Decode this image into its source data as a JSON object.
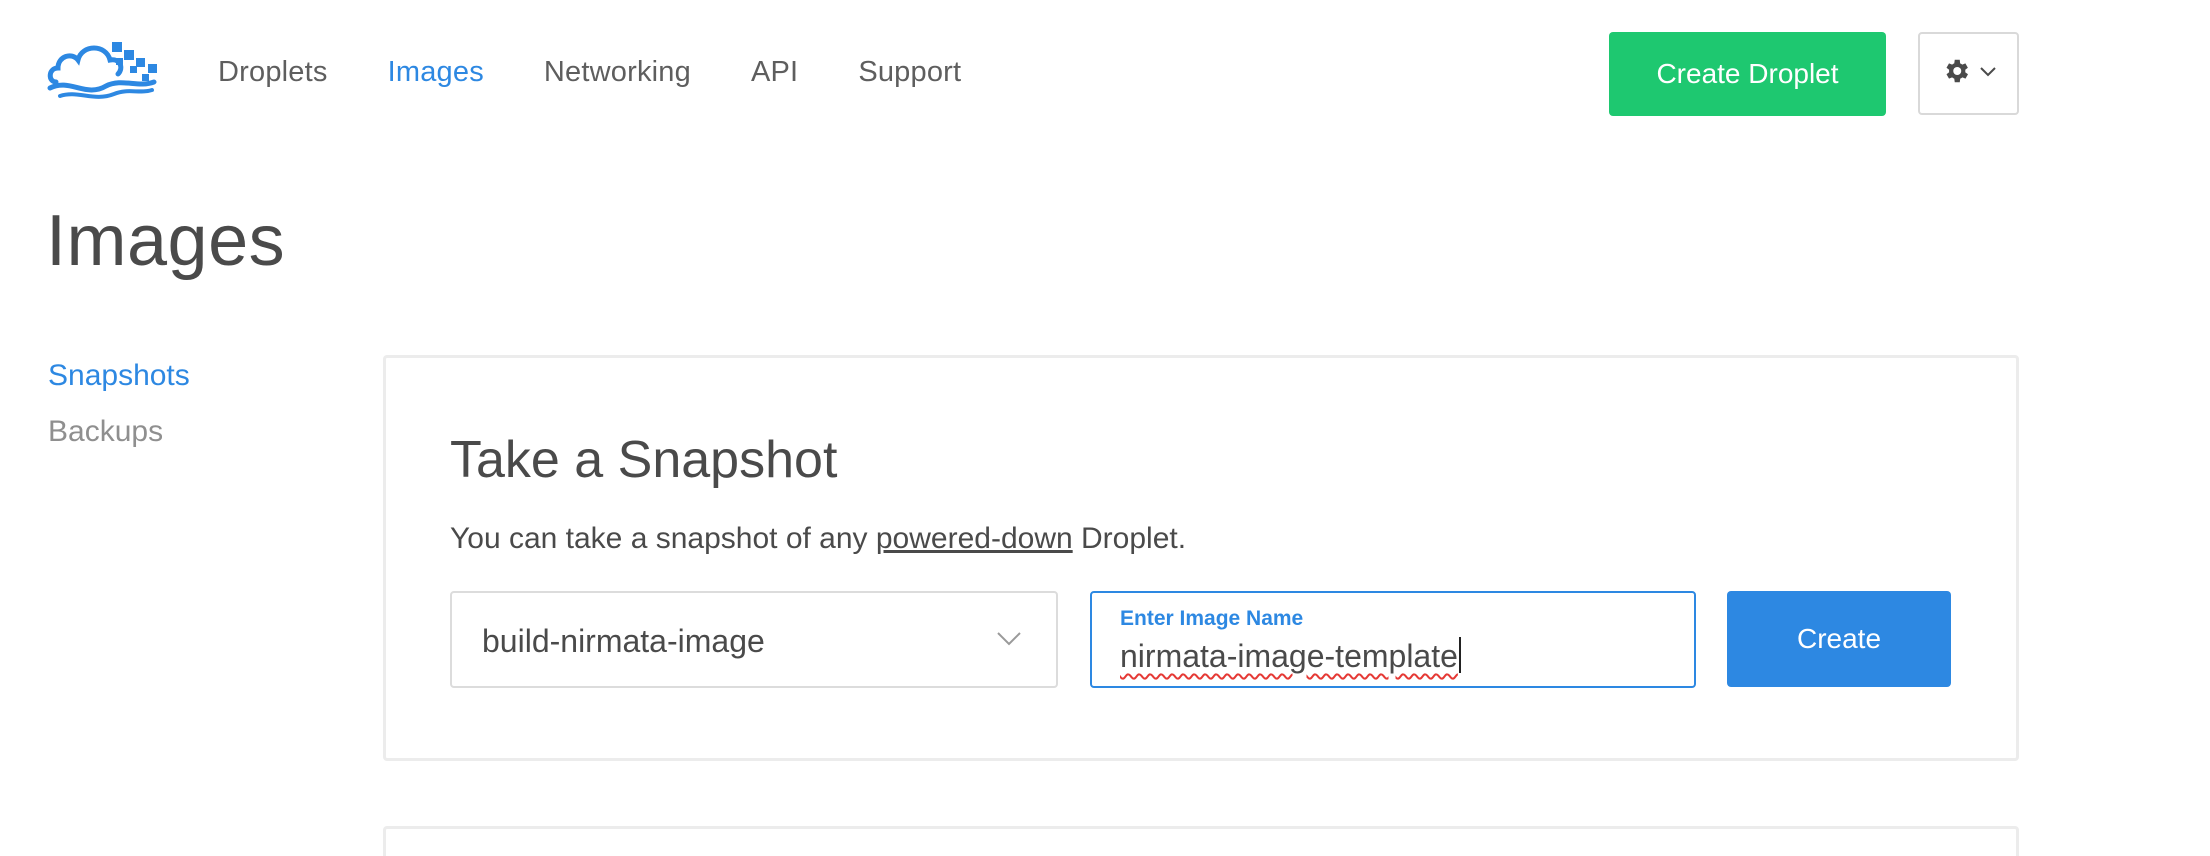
{
  "header": {
    "logo_icon": "digitalocean-cloud-logo",
    "nav": [
      {
        "label": "Droplets",
        "active": false
      },
      {
        "label": "Images",
        "active": true
      },
      {
        "label": "Networking",
        "active": false
      },
      {
        "label": "API",
        "active": false
      },
      {
        "label": "Support",
        "active": false
      }
    ],
    "create_droplet_label": "Create Droplet",
    "settings_icon": "gear-icon"
  },
  "page": {
    "title": "Images"
  },
  "sidebar": {
    "items": [
      {
        "label": "Snapshots",
        "active": true
      },
      {
        "label": "Backups",
        "active": false
      }
    ]
  },
  "snapshot_panel": {
    "title": "Take a Snapshot",
    "desc_before": "You can take a snapshot of any ",
    "desc_link": "powered-down",
    "desc_after": " Droplet.",
    "droplet_select_value": "build-nirmata-image",
    "name_field_label": "Enter Image Name",
    "name_field_value": "nirmata-image-template",
    "create_label": "Create"
  },
  "colors": {
    "accent": "#2d88e2",
    "primary_green": "#1ec870",
    "text": "#4a4a4a"
  }
}
